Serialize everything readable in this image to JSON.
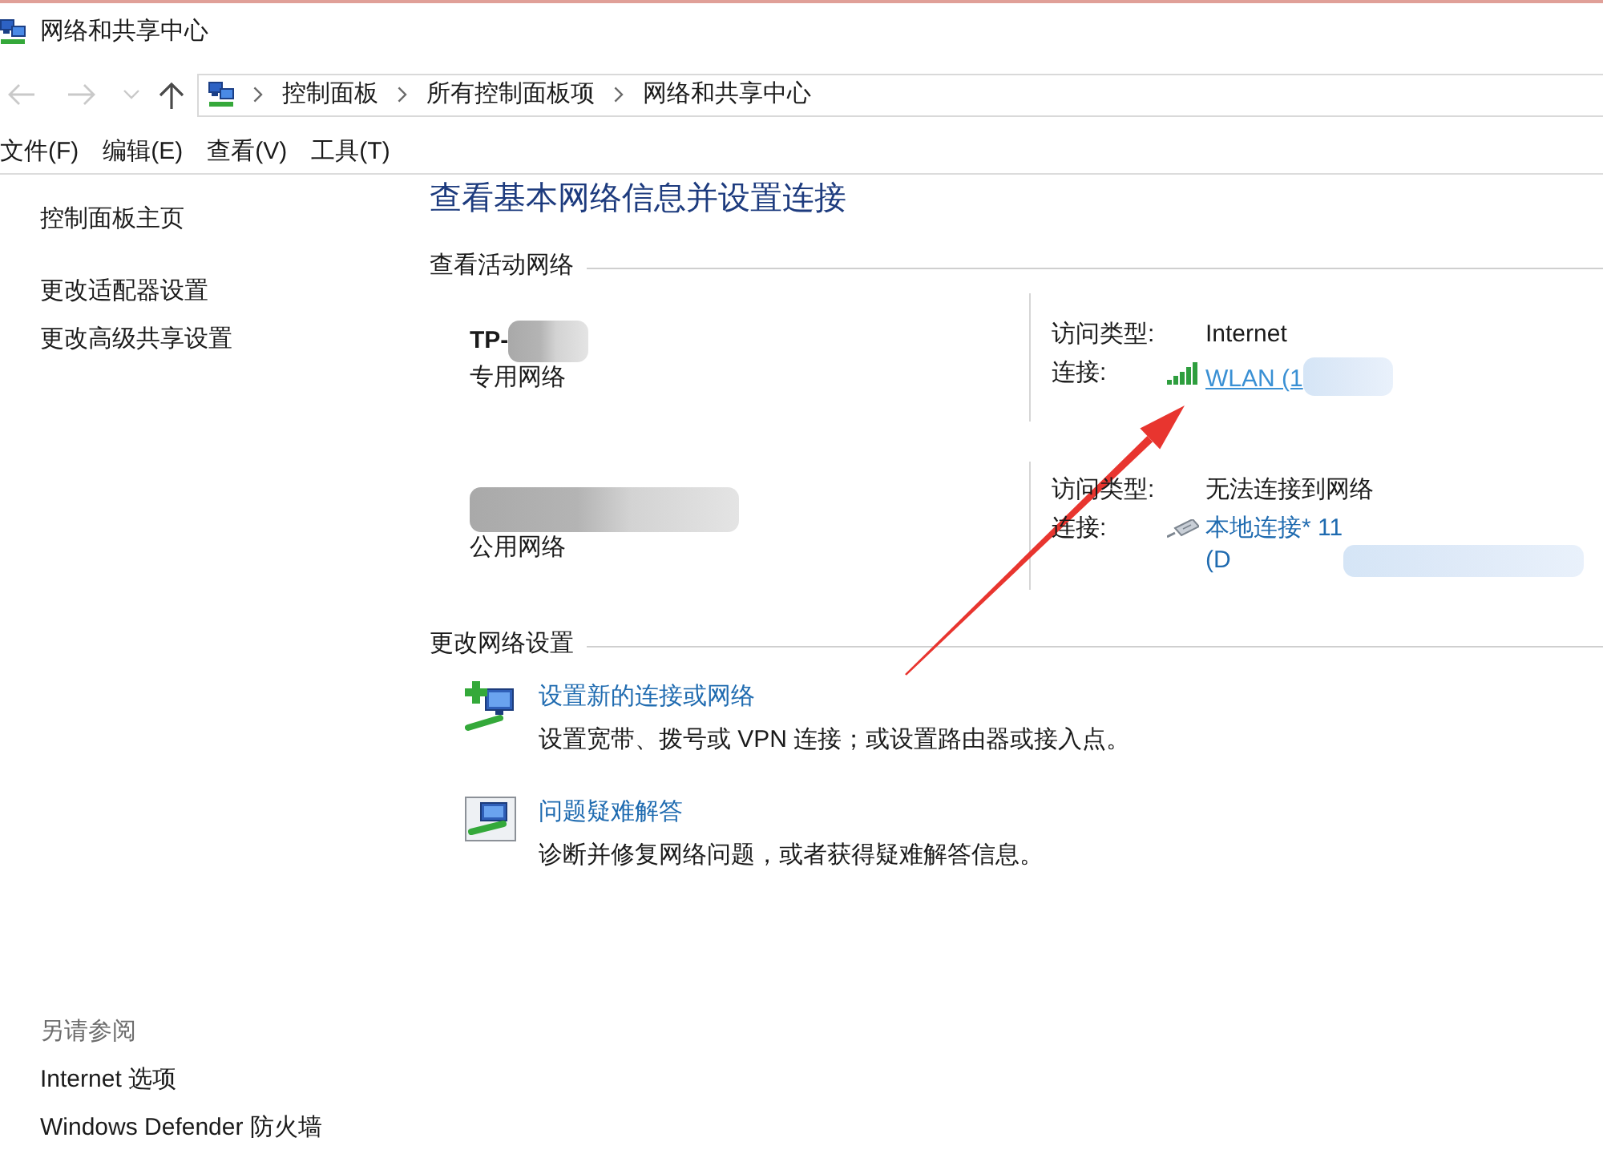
{
  "window": {
    "title": "网络和共享中心"
  },
  "navigation": {
    "buttons": [
      {
        "kind": "back",
        "disabled": true
      },
      {
        "kind": "forward",
        "disabled": true
      },
      {
        "kind": "recent",
        "disabled": true
      },
      {
        "kind": "up",
        "disabled": false
      }
    ],
    "breadcrumbs": [
      "控制面板",
      "所有控制面板项",
      "网络和共享中心"
    ]
  },
  "menu": [
    "文件(F)",
    "编辑(E)",
    "查看(V)",
    "工具(T)"
  ],
  "sidebar": {
    "home": "控制面板主页",
    "tasks": [
      "更改适配器设置",
      "更改高级共享设置"
    ],
    "see_also": {
      "title": "另请参阅",
      "items": [
        "Internet 选项",
        "Windows Defender 防火墙"
      ]
    }
  },
  "main": {
    "heading": "查看基本网络信息并设置连接",
    "active_networks": {
      "title": "查看活动网络",
      "networks": [
        {
          "name": "TP-",
          "name_blurred": true,
          "category": "专用网络",
          "access": {
            "label": "访问类型:",
            "value": "Internet"
          },
          "connection": {
            "label": "连接:",
            "kind": "wifi",
            "lines": [
              "WLAN (1"
            ],
            "blurred": true,
            "hovered": true
          }
        },
        {
          "name_blurred": true,
          "category": "公用网络",
          "access": {
            "label": "访问类型:",
            "value": "无法连接到网络"
          },
          "connection": {
            "label": "连接:",
            "kind": "ethernet",
            "lines": [
              "本地连接* 11",
              "(D"
            ],
            "blurred": true,
            "hovered": false
          }
        }
      ]
    },
    "change_settings": {
      "title": "更改网络设置",
      "actions": [
        {
          "kind": "new-connection",
          "title": "设置新的连接或网络",
          "description": "设置宽带、拨号或 VPN 连接；或设置路由器或接入点。"
        },
        {
          "kind": "troubleshoot",
          "title": "问题疑难解答",
          "description": "诊断并修复网络问题，或者获得疑难解答信息。"
        }
      ]
    }
  }
}
